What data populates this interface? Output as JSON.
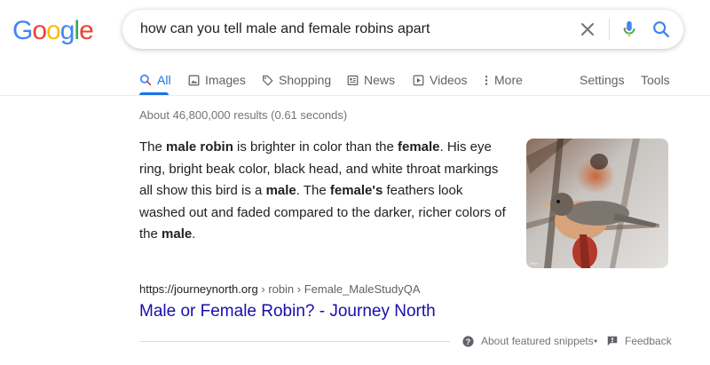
{
  "logo": {
    "letters": [
      "G",
      "o",
      "o",
      "g",
      "l",
      "e"
    ],
    "colors": [
      "#4285F4",
      "#EA4335",
      "#FBBC05",
      "#4285F4",
      "#34A853",
      "#EA4335"
    ]
  },
  "search": {
    "query": "how can you tell male and female robins apart"
  },
  "tabs": [
    {
      "label": "All",
      "icon": "search-icon",
      "active": true
    },
    {
      "label": "Images",
      "icon": "image-icon"
    },
    {
      "label": "Shopping",
      "icon": "tag-icon"
    },
    {
      "label": "News",
      "icon": "news-icon"
    },
    {
      "label": "Videos",
      "icon": "play-icon"
    },
    {
      "label": "More",
      "icon": "more-vertical-icon"
    }
  ],
  "right_tabs": {
    "settings": "Settings",
    "tools": "Tools"
  },
  "result_stats": "About 46,800,000 results (0.61 seconds)",
  "snippet": {
    "parts": [
      {
        "t": "The ",
        "b": false
      },
      {
        "t": "male robin",
        "b": true
      },
      {
        "t": " is brighter in color than the ",
        "b": false
      },
      {
        "t": "female",
        "b": true
      },
      {
        "t": ". His eye ring, bright beak color, black head, and white throat markings all show this bird is a ",
        "b": false
      },
      {
        "t": "male",
        "b": true
      },
      {
        "t": ". The ",
        "b": false
      },
      {
        "t": "female's",
        "b": true
      },
      {
        "t": " feathers look washed out and faded compared to the darker, richer colors of the ",
        "b": false
      },
      {
        "t": "male",
        "b": true
      },
      {
        "t": ".",
        "b": false
      }
    ]
  },
  "citation": {
    "domain": "https://journeynorth.org",
    "path": " › robin › Female_MaleStudyQA"
  },
  "result_title": "Male or Female Robin? - Journey North",
  "footer": {
    "about": "About featured snippets",
    "separator": "•",
    "feedback": "Feedback"
  },
  "colors": {
    "accent": "#1a73e8",
    "link": "#1a0dab"
  }
}
